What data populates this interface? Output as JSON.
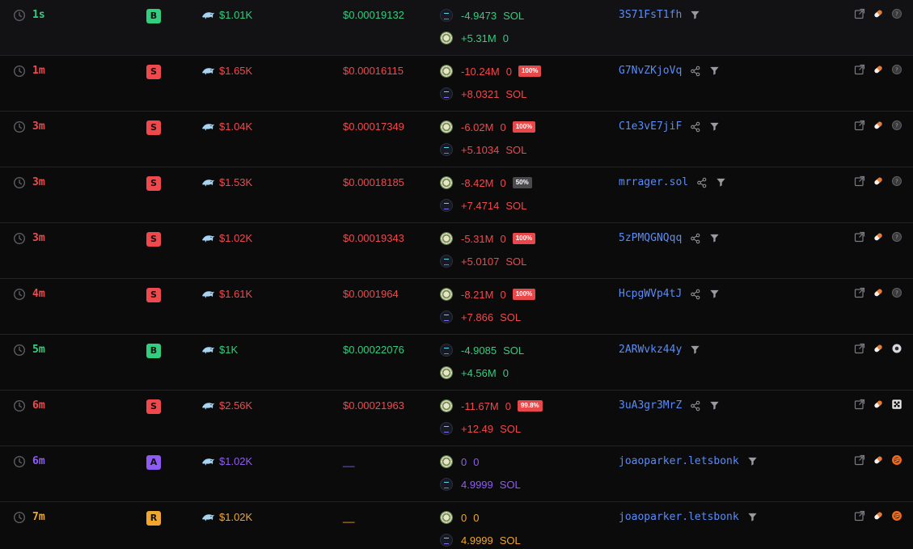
{
  "colors": {
    "buy": "#2fcf7f",
    "sell": "#f0494d",
    "add": "#8e5cf5",
    "remove": "#f0a72c",
    "maker": "#5b8cf5"
  },
  "icons": {
    "age": "clock-icon",
    "trader": "dolphin-icon",
    "sol": "solana-token-icon",
    "coin": "token-coin-icon",
    "share": "share-icon",
    "filter": "filter-icon",
    "actions": [
      "external-link-icon",
      "pill-icon",
      "status-icon"
    ]
  },
  "trades": [
    {
      "age": "1s",
      "type": "B",
      "color": "green",
      "usd": "$1.01K",
      "price": "$0.00019132",
      "line1": {
        "token": "sol",
        "amount": "-4.9473",
        "unit": "SOL",
        "pct": ""
      },
      "line2": {
        "token": "coin",
        "amount": "+5.31M",
        "unit": "0",
        "pct": ""
      },
      "maker": "3S71FsT1fh",
      "share": false,
      "status_icon": "question"
    },
    {
      "age": "1m",
      "type": "S",
      "color": "red",
      "usd": "$1.65K",
      "price": "$0.00016115",
      "line1": {
        "token": "coin",
        "amount": "-10.24M",
        "unit": "0",
        "pct": "100%"
      },
      "line2": {
        "token": "sol",
        "amount": "+8.0321",
        "unit": "SOL",
        "pct": ""
      },
      "maker": "G7NvZKjoVq",
      "share": true,
      "status_icon": "question"
    },
    {
      "age": "3m",
      "type": "S",
      "color": "red",
      "usd": "$1.04K",
      "price": "$0.00017349",
      "line1": {
        "token": "coin",
        "amount": "-6.02M",
        "unit": "0",
        "pct": "100%"
      },
      "line2": {
        "token": "sol",
        "amount": "+5.1034",
        "unit": "SOL",
        "pct": ""
      },
      "maker": "C1e3vE7jiF",
      "share": true,
      "status_icon": "question"
    },
    {
      "age": "3m",
      "type": "S",
      "color": "red",
      "usd": "$1.53K",
      "price": "$0.00018185",
      "line1": {
        "token": "coin",
        "amount": "-8.42M",
        "unit": "0",
        "pct": "50%"
      },
      "line2": {
        "token": "sol",
        "amount": "+7.4714",
        "unit": "SOL",
        "pct": ""
      },
      "maker": "mrrager.sol",
      "share": true,
      "status_icon": "question"
    },
    {
      "age": "3m",
      "type": "S",
      "color": "red",
      "usd": "$1.02K",
      "price": "$0.00019343",
      "line1": {
        "token": "coin",
        "amount": "-5.31M",
        "unit": "0",
        "pct": "100%"
      },
      "line2": {
        "token": "sol",
        "amount": "+5.0107",
        "unit": "SOL",
        "pct": ""
      },
      "maker": "5zPMQGNQqq",
      "share": true,
      "status_icon": "question"
    },
    {
      "age": "4m",
      "type": "S",
      "color": "red",
      "usd": "$1.61K",
      "price": "$0.0001964",
      "line1": {
        "token": "coin",
        "amount": "-8.21M",
        "unit": "0",
        "pct": "100%"
      },
      "line2": {
        "token": "sol",
        "amount": "+7.866",
        "unit": "SOL",
        "pct": ""
      },
      "maker": "HcpgWVp4tJ",
      "share": true,
      "status_icon": "question"
    },
    {
      "age": "5m",
      "type": "B",
      "color": "green",
      "usd": "$1K",
      "price": "$0.00022076",
      "line1": {
        "token": "sol",
        "amount": "-4.9085",
        "unit": "SOL",
        "pct": ""
      },
      "line2": {
        "token": "coin",
        "amount": "+4.56M",
        "unit": "0",
        "pct": ""
      },
      "maker": "2ARWvkz44y",
      "share": false,
      "status_icon": "circle"
    },
    {
      "age": "6m",
      "type": "S",
      "color": "red",
      "usd": "$2.56K",
      "price": "$0.00021963",
      "line1": {
        "token": "coin",
        "amount": "-11.67M",
        "unit": "0",
        "pct": "99.8%"
      },
      "line2": {
        "token": "sol",
        "amount": "+12.49",
        "unit": "SOL",
        "pct": ""
      },
      "maker": "3uA3gr3MrZ",
      "share": true,
      "status_icon": "grid"
    },
    {
      "age": "6m",
      "type": "A",
      "color": "purple",
      "usd": "$1.02K",
      "price": "__",
      "line1": {
        "token": "coin",
        "amount": "0",
        "unit": "0",
        "pct": ""
      },
      "line2": {
        "token": "sol",
        "amount": "4.9999",
        "unit": "SOL",
        "pct": ""
      },
      "maker": "joaoparker.letsbonk",
      "share": false,
      "status_icon": "bonk"
    },
    {
      "age": "7m",
      "type": "R",
      "color": "orange",
      "usd": "$1.02K",
      "price": "__",
      "line1": {
        "token": "coin",
        "amount": "0",
        "unit": "0",
        "pct": ""
      },
      "line2": {
        "token": "sol",
        "amount": "4.9999",
        "unit": "SOL",
        "pct": ""
      },
      "maker": "joaoparker.letsbonk",
      "share": false,
      "status_icon": "bonk"
    }
  ]
}
